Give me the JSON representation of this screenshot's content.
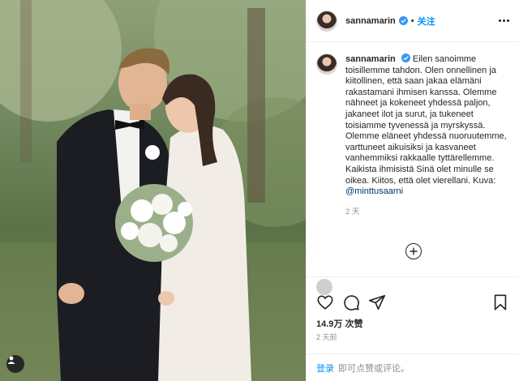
{
  "post": {
    "username": "sannamarin",
    "follow_label": "关注",
    "caption": "Eilen sanoimme toisillemme tahdon. Olen onnellinen ja kiitollinen, että saan jakaa elämäni rakastamani ihmisen kanssa. Olemme nähneet ja kokeneet yhdessä paljon, jakaneet ilot ja surut, ja tukeneet toisiamme tyvenessä ja myrskyssä. Olemme eläneet yhdessä nuoruutemme, varttuneet aikuisiksi ja kasvaneet vanhemmiksi rakkaalle tyttärellemme. Kaikista ihmisistä Sinä olet minulle se oikea. Kiitos, että olet vierellani. Kuva: ",
    "caption_mention": "@minttusaarni",
    "caption_time": "2 天",
    "likes": "14.9万 次赞",
    "post_age": "2 天前"
  },
  "footer": {
    "login_label": "登录",
    "login_rest": "即可点赞或评论。"
  },
  "icons": {
    "verified": "verified-badge-icon",
    "more": "more-options-icon",
    "load_more": "load-more-comments-icon",
    "like": "heart-icon",
    "comment": "comment-bubble-icon",
    "share": "paper-plane-icon",
    "save": "bookmark-icon",
    "photo_user": "user-tag-icon"
  },
  "colors": {
    "accent": "#0095f6",
    "text": "#262626",
    "muted": "#8e8e8e",
    "border": "#efefef"
  }
}
